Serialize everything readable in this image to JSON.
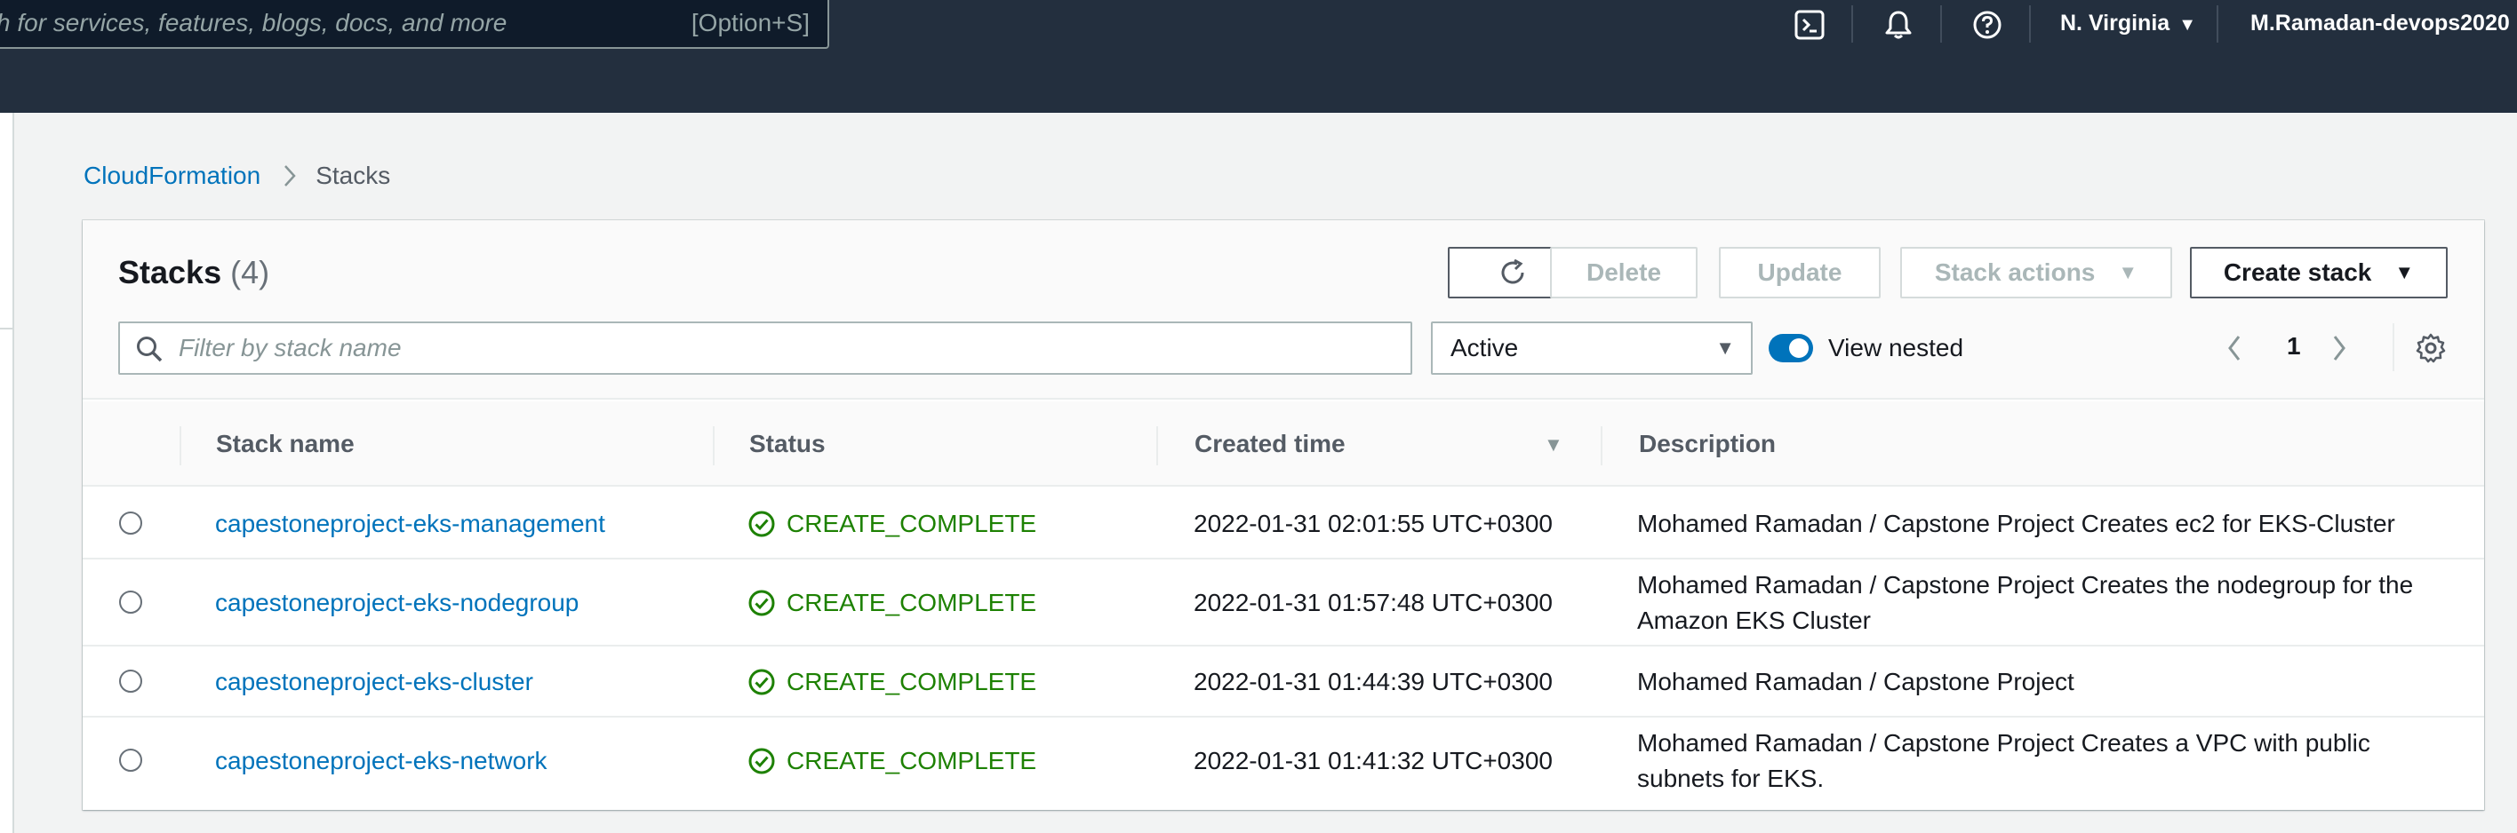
{
  "topnav": {
    "search_placeholder": "h for services, features, blogs, docs, and more",
    "search_shortcut": "[Option+S]",
    "icons": [
      "cloudshell-icon",
      "bell-icon",
      "help-icon"
    ],
    "region": "N. Virginia",
    "account": "M.Ramadan-devops2020"
  },
  "breadcrumb": {
    "root": "CloudFormation",
    "current": "Stacks"
  },
  "panel": {
    "title": "Stacks",
    "count": "(4)",
    "buttons": {
      "refresh": "refresh-icon",
      "delete": "Delete",
      "update": "Update",
      "stack_actions": "Stack actions",
      "create_stack": "Create stack"
    },
    "filter": {
      "placeholder": "Filter by stack name",
      "value": ""
    },
    "status_filter": "Active",
    "view_nested": {
      "label": "View nested",
      "on": true
    },
    "pagination": {
      "page": "1"
    }
  },
  "table": {
    "columns": [
      "Stack name",
      "Status",
      "Created time",
      "Description"
    ],
    "rows": [
      {
        "name": "capestoneproject-eks-management",
        "status": "CREATE_COMPLETE",
        "created": "2022-01-31 02:01:55 UTC+0300",
        "description_lines": [
          "Mohamed Ramadan / Capstone Project Creates ec2 for EKS-Cluster"
        ]
      },
      {
        "name": "capestoneproject-eks-nodegroup",
        "status": "CREATE_COMPLETE",
        "created": "2022-01-31 01:57:48 UTC+0300",
        "description_lines": [
          "Mohamed Ramadan / Capstone Project Creates the nodegroup for the",
          "Amazon EKS Cluster"
        ]
      },
      {
        "name": "capestoneproject-eks-cluster",
        "status": "CREATE_COMPLETE",
        "created": "2022-01-31 01:44:39 UTC+0300",
        "description_lines": [
          "Mohamed Ramadan / Capstone Project"
        ]
      },
      {
        "name": "capestoneproject-eks-network",
        "status": "CREATE_COMPLETE",
        "created": "2022-01-31 01:41:32 UTC+0300",
        "description_lines": [
          "Mohamed Ramadan / Capstone Project Creates a VPC with public",
          "subnets for EKS."
        ]
      }
    ]
  },
  "colors": {
    "nav_bg": "#232f3e",
    "link": "#0073bb",
    "success": "#1d8102",
    "toggle": "#0073bb"
  }
}
